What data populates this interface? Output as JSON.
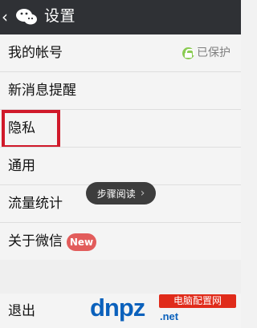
{
  "header": {
    "back_icon": "chevron-left-icon",
    "app_icon": "wechat-bubbles-icon",
    "title": "设置"
  },
  "menu": {
    "items": [
      {
        "label": "我的帐号",
        "status_text": "已保护",
        "status_icon": "lock-icon"
      },
      {
        "label": "新消息提醒"
      },
      {
        "label": "隐私"
      },
      {
        "label": "通用"
      },
      {
        "label": "流量统计"
      },
      {
        "label": "关于微信",
        "badge_text": "New"
      },
      {
        "label": "退出"
      }
    ]
  },
  "overlay": {
    "toast_text": "步骤阅读",
    "toast_icon": "chevron-right-icon"
  },
  "watermark": {
    "letters": "dnpz",
    "suffix": ".net",
    "tagline": "电脑配置网"
  },
  "colors": {
    "topbar_bg": "#2f3135",
    "highlight_border": "#d0192a",
    "badge_bg": "#e25c5b",
    "lock_green": "#8acb52",
    "watermark_blue": "#0b61bc",
    "watermark_red": "#e02b1a"
  }
}
